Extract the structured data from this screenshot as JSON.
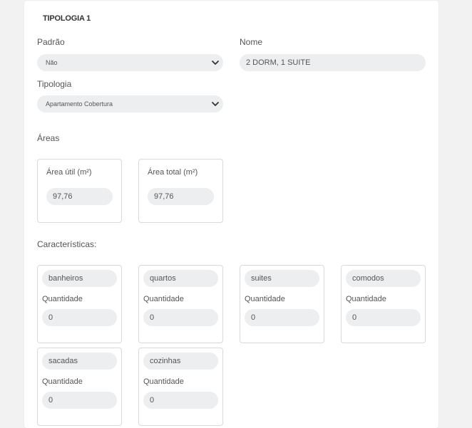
{
  "section_title": "TIPOLOGIA 1",
  "padrao": {
    "label": "Padrão",
    "value": "Não"
  },
  "nome": {
    "label": "Nome",
    "value": "2 DORM, 1 SUITE"
  },
  "tipologia": {
    "label": "Tipologia",
    "value": "Apartamento Cobertura"
  },
  "areas": {
    "heading": "Áreas",
    "util": {
      "label": "Área útil (m²)",
      "value": "97,76"
    },
    "total": {
      "label": "Área total (m²)",
      "value": "97,76"
    }
  },
  "caracteristicas": {
    "heading": "Características:",
    "items": [
      {
        "name": "banheiros",
        "qty_label": "Quantidade",
        "qty": "0"
      },
      {
        "name": "quartos",
        "qty_label": "Quantidade",
        "qty": "0"
      },
      {
        "name": "suites",
        "qty_label": "Quantidade",
        "qty": "0"
      },
      {
        "name": "comodos",
        "qty_label": "Quantidade",
        "qty": "0"
      },
      {
        "name": "sacadas",
        "qty_label": "Quantidade",
        "qty": "0"
      },
      {
        "name": "cozinhas",
        "qty_label": "Quantidade",
        "qty": "0"
      }
    ]
  },
  "icons": {
    "select_arrow": "chevron-down-icon"
  },
  "colors": {
    "field_bg": "#eceef0",
    "border": "#d9d9d9"
  }
}
